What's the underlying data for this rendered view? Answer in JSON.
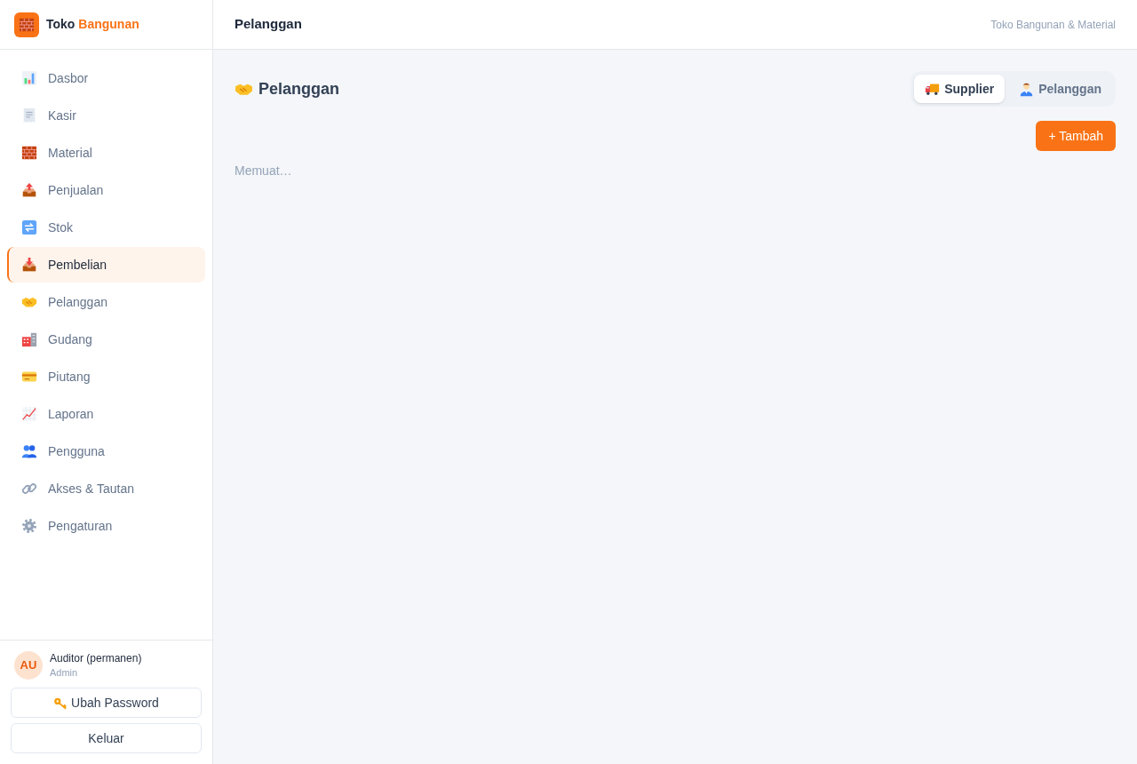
{
  "sidebar": {
    "brand": {
      "name": "Toko",
      "accent": "Bangunan"
    },
    "nav_items": [
      {
        "label": "Dasbor",
        "selected": false
      },
      {
        "label": "Kasir",
        "selected": false
      },
      {
        "label": "Material",
        "selected": false
      },
      {
        "label": "Penjualan",
        "selected": false
      },
      {
        "label": "Stok",
        "selected": false
      },
      {
        "label": "Pembelian",
        "selected": true
      },
      {
        "label": "Pelanggan",
        "selected": false
      },
      {
        "label": "Gudang",
        "selected": false
      },
      {
        "label": "Piutang",
        "selected": false
      },
      {
        "label": "Laporan",
        "selected": false
      },
      {
        "label": "Pengguna",
        "selected": false
      },
      {
        "label": "Akses & Tautan",
        "selected": false
      },
      {
        "label": "Pengaturan",
        "selected": false
      }
    ],
    "user": {
      "initials": "AU",
      "name": "Auditor (permanen)",
      "role": "Admin"
    },
    "buttons": [
      {
        "label": "Ubah Password",
        "kind": "password"
      },
      {
        "label": "Keluar",
        "kind": "plain"
      }
    ]
  },
  "header": {
    "title": "Pelanggan",
    "store_name": "Toko Bangunan & Material"
  },
  "page": {
    "heading": "Pelanggan",
    "tabs": [
      {
        "label": "Supplier",
        "selected": true
      },
      {
        "label": "Pelanggan",
        "selected": false
      }
    ],
    "add_button": "+ Tambah",
    "loading_text": "Memuat…"
  }
}
